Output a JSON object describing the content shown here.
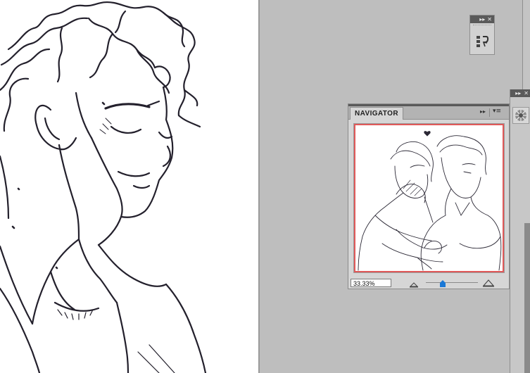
{
  "navigator": {
    "tab_label": "NAVIGATOR",
    "zoom_value": "33.33%",
    "zoom_slider_fraction": 0.33
  },
  "panels": {
    "history_panel_icon": "history-icon",
    "dock_panel_icon": "brush-preset-icon",
    "collapse_icon": "double-chevron-right-icon",
    "close_icon": "close-icon",
    "menu_icon": "panel-menu-icon"
  },
  "colors": {
    "workspace_bg": "#bcbcbc",
    "view_frame": "#e05a5a",
    "slider_thumb": "#1a78d6"
  }
}
